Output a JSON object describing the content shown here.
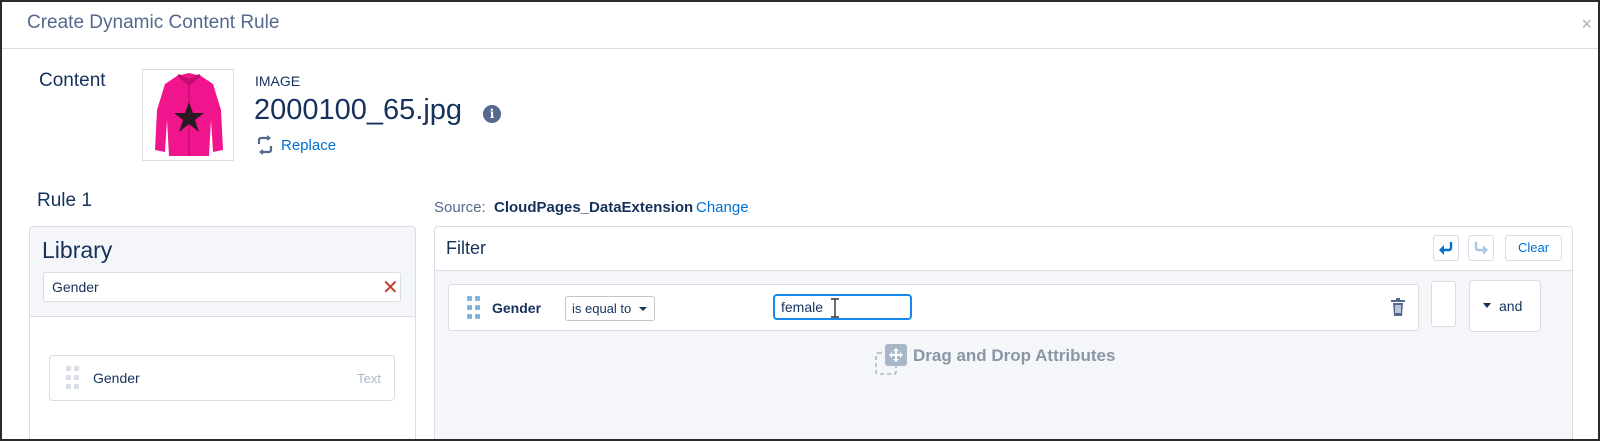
{
  "modal": {
    "title": "Create Dynamic Content Rule",
    "close_icon": "close-icon",
    "close_glyph": "×"
  },
  "content": {
    "label": "Content",
    "type": "IMAGE",
    "filename": "2000100_65.jpg",
    "info_glyph": "i",
    "replace_label": "Replace"
  },
  "rule": {
    "title": "Rule 1"
  },
  "library": {
    "title": "Library",
    "search_value": "Gender",
    "clear_glyph": "✕",
    "items": [
      {
        "label": "Gender",
        "type": "Text"
      }
    ]
  },
  "source": {
    "prefix": "Source:",
    "name": "CloudPages_DataExtension",
    "change_label": "Change"
  },
  "filter": {
    "title": "Filter",
    "clear_label": "Clear",
    "condition": {
      "field": "Gender",
      "operator": "is equal to",
      "value": "female"
    },
    "conjunction": "and",
    "drop_hint": "Drag and Drop Attributes"
  },
  "colors": {
    "brand_blue": "#0070d2",
    "text_dark": "#16325c",
    "text_muted": "#54698d",
    "delete_red": "#c23934",
    "jacket_pink": "#f0158d"
  }
}
